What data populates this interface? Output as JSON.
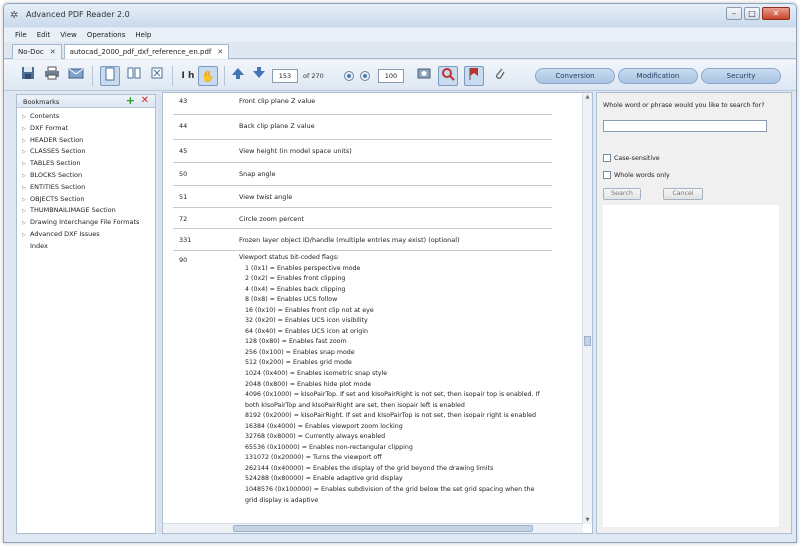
{
  "window": {
    "title": "Advanced PDF Reader 2.0",
    "controls": [
      "–",
      "□",
      "✕"
    ]
  },
  "menu": [
    "File",
    "Edit",
    "View",
    "Operations",
    "Help"
  ],
  "tabs": [
    {
      "label": "No-Doc",
      "close": "✕"
    },
    {
      "label": "autocad_2000_pdf_dxf_reference_en.pdf",
      "close": "✕"
    }
  ],
  "toolbar": {
    "page_current": "153",
    "page_total": "of 270",
    "zoom": "100",
    "buttons": [
      "Conversion",
      "Modification",
      "Security"
    ]
  },
  "left_panel": {
    "title": "Bookmarks",
    "add": "+",
    "remove": "✕",
    "items": [
      "Contents",
      "DXF Format",
      "HEADER Section",
      "CLASSES Section",
      "TABLES Section",
      "BLOCKS Section",
      "ENTITIES Section",
      "OBJECTS Section",
      "THUMBNAILIMAGE Section",
      "Drawing Interchange File Formats",
      "Advanced DXF Issues",
      "Index"
    ]
  },
  "document": {
    "rows": [
      {
        "code": "43",
        "desc": "Front clip plane Z value"
      },
      {
        "code": "44",
        "desc": "Back clip plane Z value"
      },
      {
        "code": "45",
        "desc": "View height (in model space units)"
      },
      {
        "code": "50",
        "desc": "Snap angle"
      },
      {
        "code": "51",
        "desc": "View twist angle"
      },
      {
        "code": "72",
        "desc": "Circle zoom percent"
      },
      {
        "code": "331",
        "desc": "Frozen layer object ID/handle (multiple entries may exist) (optional)"
      }
    ],
    "flags_code": "90",
    "flags": [
      "Viewport status bit-coded flags:",
      "1 (0x1) = Enables perspective mode",
      "2 (0x2) = Enables front clipping",
      "4 (0x4) = Enables back clipping",
      "8 (0x8) = Enables UCS follow",
      "16 (0x10) = Enables front clip not at eye",
      "32 (0x20) = Enables UCS icon visibility",
      "64 (0x40) = Enables UCS icon at origin",
      "128 (0x80) = Enables fast zoom",
      "256 (0x100) = Enables snap mode",
      "512 (0x200) = Enables grid mode",
      "1024 (0x400) = Enables isometric snap style",
      "2048 (0x800) = Enables hide plot mode",
      "4096 (0x1000) = kIsoPairTop. If set and kIsoPairRight is not set, then isopair top is enabled. If",
      "both kIsoPairTop and kIsoPairRight are set, then isopair left is enabled",
      "8192 (0x2000) = kIsoPairRight. If set and kIsoPairTop is not set, then isopair right is enabled",
      "16384 (0x4000) = Enables viewport zoom locking",
      "32768 (0x8000) = Currently always enabled",
      "65536 (0x10000) = Enables non-rectangular clipping",
      "131072 (0x20000) = Turns the viewport off",
      "262144 (0x40000) = Enables the display of the grid beyond the drawing limits",
      "524288 (0x80000) = Enable adaptive grid display",
      "1048576 (0x100000) = Enables subdivision of the grid below the set grid spacing when the",
      "grid display is adaptive"
    ]
  },
  "search_panel": {
    "prompt": "Whole word or phrase would you like to search for?",
    "input_value": "",
    "case_sensitive": "Case-sensitive",
    "whole_words": "Whole words only",
    "search_button": "Search",
    "cancel_button": "Cancel"
  },
  "colors": {
    "accent": "#a8c4e2",
    "window_bg": "#dde8f4",
    "add_icon": "#2b9a2b",
    "remove_icon": "#c53030"
  }
}
